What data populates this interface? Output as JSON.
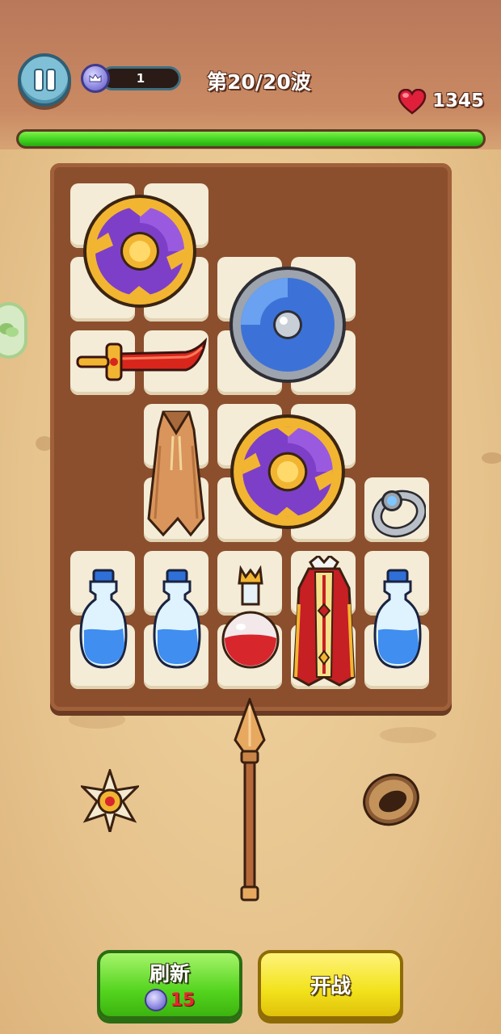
{
  "hud": {
    "gem_count": "1",
    "wave_label": "第20/20波",
    "hp_value": "1345",
    "hp_fraction": 1.0
  },
  "buttons": {
    "refresh_label": "刷新",
    "refresh_cost": "15",
    "start_label": "开战"
  },
  "colors": {
    "hp_green": "#3ccf1d",
    "board_brown": "#8b4f2e",
    "refresh_green": "#54d41e",
    "start_yellow": "#f2e21b"
  },
  "icons": [
    "pause-icon",
    "gem-crown-icon",
    "heart-icon",
    "chat-icon",
    "purple-shield-icon",
    "blue-shield-icon",
    "red-dagger-icon",
    "brown-cloak-icon",
    "silver-ring-icon",
    "blue-potion-icon",
    "red-potion-icon",
    "royal-robe-icon",
    "spear-icon",
    "shuriken-icon",
    "wooden-ring-icon"
  ]
}
